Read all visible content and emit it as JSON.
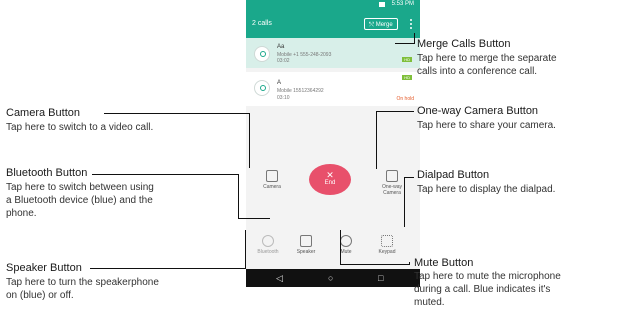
{
  "status_bar": {
    "time": "5:53 PM"
  },
  "header": {
    "title": "2 calls",
    "merge_label": "Merge"
  },
  "calls": [
    {
      "name": "Aa",
      "detail": "Mobile +1 555-248-2093",
      "duration": "03:02",
      "badge": "HD"
    },
    {
      "name": "A",
      "detail": "Mobile 15512364292",
      "duration": "03:10",
      "badge": "HD",
      "status": "On hold"
    }
  ],
  "controls": {
    "camera": "Camera",
    "end": "End",
    "oneway_line1": "One-way",
    "oneway_line2": "Camera",
    "bluetooth": "Bluetooth",
    "speaker": "Speaker",
    "mute": "Mute",
    "keypad": "Keypad"
  },
  "annotations": {
    "merge": {
      "title": "Merge Calls Button",
      "desc1": "Tap here to merge the separate",
      "desc2": "calls into a conference call."
    },
    "oneway": {
      "title": "One-way Camera Button",
      "desc1": "Tap here to share your camera."
    },
    "camera": {
      "title": "Camera Button",
      "desc1": "Tap here to switch to a video call."
    },
    "dialpad": {
      "title": "Dialpad Button",
      "desc1": "Tap here to display the dialpad."
    },
    "bluetooth": {
      "title": "Bluetooth Button",
      "desc1": "Tap here to switch between using",
      "desc2": "a Bluetooth device (blue) and the",
      "desc3": "phone."
    },
    "mute": {
      "title": "Mute Button",
      "desc1": "Tap here to mute the microphone",
      "desc2": "during a call. Blue indicates it's",
      "desc3": "muted."
    },
    "speaker": {
      "title": "Speaker Button",
      "desc1": "Tap here to turn the speakerphone",
      "desc2": "on (blue) or off."
    }
  },
  "colors": {
    "accent": "#1aa88b",
    "end": "#e8506b",
    "hold": "#e55c2b"
  }
}
